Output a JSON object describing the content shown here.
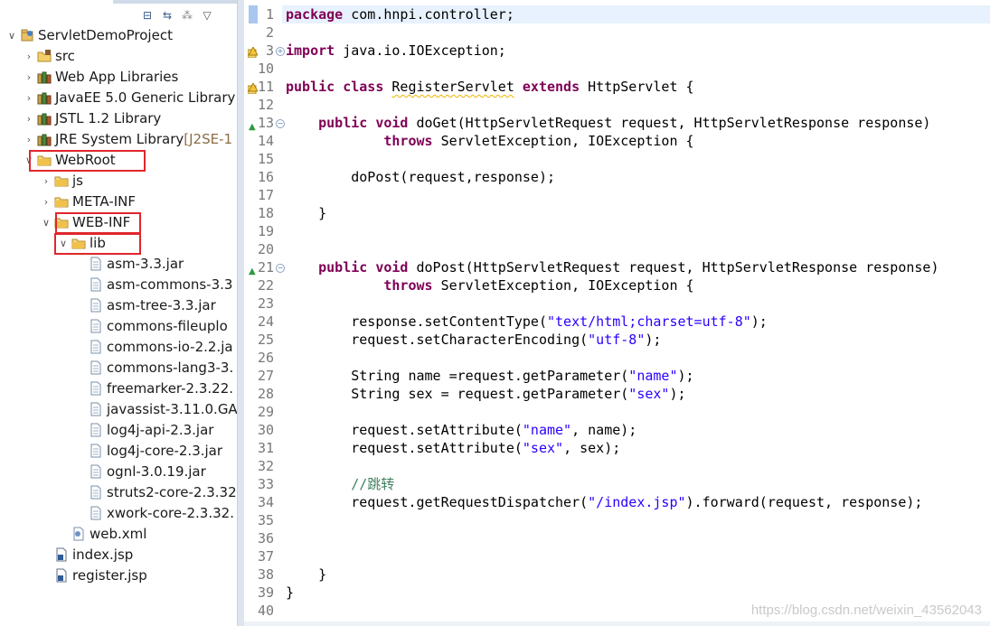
{
  "explorer": {
    "toolbar_icons": [
      "collapse-all-icon",
      "link-with-editor-icon",
      "filters-icon",
      "view-menu-icon"
    ],
    "tree": [
      {
        "label": "ServletDemoProject",
        "icon": "project-icon",
        "twisty": "expanded"
      },
      {
        "label": "src",
        "icon": "source-folder-icon",
        "twisty": "collapsed"
      },
      {
        "label": "Web App Libraries",
        "icon": "library-icon",
        "twisty": "collapsed"
      },
      {
        "label": "JavaEE 5.0 Generic Library",
        "icon": "library-icon",
        "twisty": "collapsed"
      },
      {
        "label": "JSTL 1.2 Library",
        "icon": "library-icon",
        "twisty": "collapsed"
      },
      {
        "label": "JRE System Library",
        "suffix": "[J2SE-1",
        "icon": "library-icon",
        "twisty": "collapsed"
      },
      {
        "label": "WebRoot",
        "icon": "folder-icon",
        "twisty": "expanded"
      },
      {
        "label": "js",
        "icon": "folder-icon",
        "twisty": "collapsed"
      },
      {
        "label": "META-INF",
        "icon": "folder-icon",
        "twisty": "collapsed"
      },
      {
        "label": "WEB-INF",
        "icon": "folder-icon",
        "twisty": "expanded"
      },
      {
        "label": "lib",
        "icon": "folder-icon",
        "twisty": "expanded"
      },
      {
        "label": "asm-3.3.jar",
        "icon": "jar-file-icon"
      },
      {
        "label": "asm-commons-3.3",
        "icon": "jar-file-icon"
      },
      {
        "label": "asm-tree-3.3.jar",
        "icon": "jar-file-icon"
      },
      {
        "label": "commons-fileuplo",
        "icon": "jar-file-icon"
      },
      {
        "label": "commons-io-2.2.ja",
        "icon": "jar-file-icon"
      },
      {
        "label": "commons-lang3-3.",
        "icon": "jar-file-icon"
      },
      {
        "label": "freemarker-2.3.22.",
        "icon": "jar-file-icon"
      },
      {
        "label": "javassist-3.11.0.GA",
        "icon": "jar-file-icon"
      },
      {
        "label": "log4j-api-2.3.jar",
        "icon": "jar-file-icon"
      },
      {
        "label": "log4j-core-2.3.jar",
        "icon": "jar-file-icon"
      },
      {
        "label": "ognl-3.0.19.jar",
        "icon": "jar-file-icon"
      },
      {
        "label": "struts2-core-2.3.32",
        "icon": "jar-file-icon"
      },
      {
        "label": "xwork-core-2.3.32.",
        "icon": "jar-file-icon"
      },
      {
        "label": "web.xml",
        "icon": "xml-file-icon"
      },
      {
        "label": "index.jsp",
        "icon": "jsp-file-icon"
      },
      {
        "label": "register.jsp",
        "icon": "jsp-file-icon"
      }
    ]
  },
  "editor": {
    "lines": [
      {
        "n": "1",
        "tokens": [
          [
            "kw",
            "package"
          ],
          [
            "p",
            " com.hnpi.controller;"
          ]
        ]
      },
      {
        "n": "2",
        "tokens": []
      },
      {
        "n": "3",
        "marker": "warning-fold",
        "tokens": [
          [
            "kw",
            "import"
          ],
          [
            "p",
            " java.io.IOException;"
          ]
        ]
      },
      {
        "n": "10",
        "tokens": []
      },
      {
        "n": "11",
        "marker": "warning",
        "tokens": [
          [
            "kw",
            "public"
          ],
          [
            "p",
            " "
          ],
          [
            "kw",
            "class"
          ],
          [
            "p",
            " "
          ],
          [
            "sq",
            "RegisterServlet"
          ],
          [
            "p",
            " "
          ],
          [
            "kw",
            "extends"
          ],
          [
            "p",
            " HttpServlet {"
          ]
        ]
      },
      {
        "n": "12",
        "tokens": []
      },
      {
        "n": "13",
        "marker": "override-fold",
        "tokens": [
          [
            "p",
            "    "
          ],
          [
            "kw",
            "public"
          ],
          [
            "p",
            " "
          ],
          [
            "kw",
            "void"
          ],
          [
            "p",
            " doGet(HttpServletRequest request, HttpServletResponse response)"
          ]
        ]
      },
      {
        "n": "14",
        "tokens": [
          [
            "p",
            "            "
          ],
          [
            "kw",
            "throws"
          ],
          [
            "p",
            " ServletException, IOException {"
          ]
        ]
      },
      {
        "n": "15",
        "tokens": []
      },
      {
        "n": "16",
        "tokens": [
          [
            "p",
            "        doPost(request,response);"
          ]
        ]
      },
      {
        "n": "17",
        "tokens": []
      },
      {
        "n": "18",
        "tokens": [
          [
            "p",
            "    }"
          ]
        ]
      },
      {
        "n": "19",
        "tokens": []
      },
      {
        "n": "20",
        "tokens": []
      },
      {
        "n": "21",
        "marker": "override-fold",
        "tokens": [
          [
            "p",
            "    "
          ],
          [
            "kw",
            "public"
          ],
          [
            "p",
            " "
          ],
          [
            "kw",
            "void"
          ],
          [
            "p",
            " doPost(HttpServletRequest request, HttpServletResponse response)"
          ]
        ]
      },
      {
        "n": "22",
        "tokens": [
          [
            "p",
            "            "
          ],
          [
            "kw",
            "throws"
          ],
          [
            "p",
            " ServletException, IOException {"
          ]
        ]
      },
      {
        "n": "23",
        "tokens": []
      },
      {
        "n": "24",
        "tokens": [
          [
            "p",
            "        response.setContentType("
          ],
          [
            "str",
            "\"text/html;charset=utf-8\""
          ],
          [
            "p",
            ");"
          ]
        ]
      },
      {
        "n": "25",
        "tokens": [
          [
            "p",
            "        request.setCharacterEncoding("
          ],
          [
            "str",
            "\"utf-8\""
          ],
          [
            "p",
            ");"
          ]
        ]
      },
      {
        "n": "26",
        "tokens": []
      },
      {
        "n": "27",
        "tokens": [
          [
            "p",
            "        String name =request.getParameter("
          ],
          [
            "str",
            "\"name\""
          ],
          [
            "p",
            ");"
          ]
        ]
      },
      {
        "n": "28",
        "tokens": [
          [
            "p",
            "        String sex = request.getParameter("
          ],
          [
            "str",
            "\"sex\""
          ],
          [
            "p",
            ");"
          ]
        ]
      },
      {
        "n": "29",
        "tokens": []
      },
      {
        "n": "30",
        "tokens": [
          [
            "p",
            "        request.setAttribute("
          ],
          [
            "str",
            "\"name\""
          ],
          [
            "p",
            ", name);"
          ]
        ]
      },
      {
        "n": "31",
        "tokens": [
          [
            "p",
            "        request.setAttribute("
          ],
          [
            "str",
            "\"sex\""
          ],
          [
            "p",
            ", sex);"
          ]
        ]
      },
      {
        "n": "32",
        "tokens": []
      },
      {
        "n": "33",
        "tokens": [
          [
            "p",
            "        "
          ],
          [
            "cmt",
            "//跳转"
          ]
        ]
      },
      {
        "n": "34",
        "tokens": [
          [
            "p",
            "        request.getRequestDispatcher("
          ],
          [
            "str",
            "\"/index.jsp\""
          ],
          [
            "p",
            ").forward(request, response);"
          ]
        ]
      },
      {
        "n": "35",
        "tokens": []
      },
      {
        "n": "36",
        "tokens": []
      },
      {
        "n": "37",
        "tokens": []
      },
      {
        "n": "38",
        "tokens": [
          [
            "p",
            "    }"
          ]
        ]
      },
      {
        "n": "39",
        "tokens": [
          [
            "p",
            "}"
          ]
        ]
      },
      {
        "n": "40",
        "tokens": []
      }
    ]
  },
  "watermark": "https://blog.csdn.net/weixin_43562043",
  "colors": {
    "keyword": "#7f0055",
    "string": "#2a00ff",
    "comment": "#3f7f5f",
    "line_number": "#787878",
    "highlight_box": "#e0262d",
    "current_line": "#e8f2fe"
  }
}
